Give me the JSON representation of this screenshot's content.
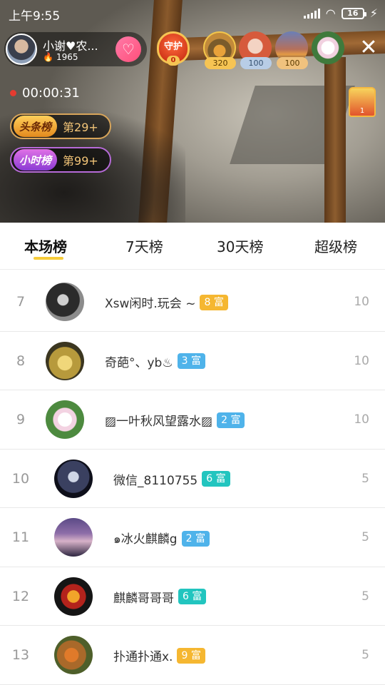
{
  "status_bar": {
    "time": "上午9:55",
    "battery": "16"
  },
  "host": {
    "name": "小谢♥农...",
    "fans": "1965"
  },
  "guard": {
    "label": "守护",
    "count": "0"
  },
  "viewers": [
    {
      "badge": "320"
    },
    {
      "badge": "100"
    },
    {
      "badge": "100"
    },
    {
      "badge": ""
    }
  ],
  "live": {
    "duration": "00:00:31",
    "castle_count": "1"
  },
  "rank_pills": [
    {
      "tag": "头条榜",
      "rank": "第29+"
    },
    {
      "tag": "小时榜",
      "rank": "第99+"
    }
  ],
  "tabs": [
    "本场榜",
    "7天榜",
    "30天榜",
    "超级榜"
  ],
  "ranking": [
    {
      "rank": "7",
      "name": "Xsw闲时.玩会 ~",
      "level": "8 富",
      "level_color": "#f5b731",
      "score": "10"
    },
    {
      "rank": "8",
      "name": "奇葩°、yb♨",
      "level": "3 富",
      "level_color": "#4fb3ea",
      "score": "10"
    },
    {
      "rank": "9",
      "name": "▨一叶秋风望露水▨",
      "level": "2 富",
      "level_color": "#4fb3ea",
      "score": "10"
    },
    {
      "rank": "10",
      "name": "微信_8110755",
      "level": "6 富",
      "level_color": "#22c5bf",
      "score": "5"
    },
    {
      "rank": "11",
      "name": "๑冰火麒麟g",
      "level": "2 富",
      "level_color": "#4fb3ea",
      "score": "5"
    },
    {
      "rank": "12",
      "name": "麒麟哥哥哥",
      "level": "6 富",
      "level_color": "#22c5bf",
      "score": "5"
    },
    {
      "rank": "13",
      "name": "扑通扑通x.",
      "level": "9 富",
      "level_color": "#f5b731",
      "score": "5"
    }
  ]
}
